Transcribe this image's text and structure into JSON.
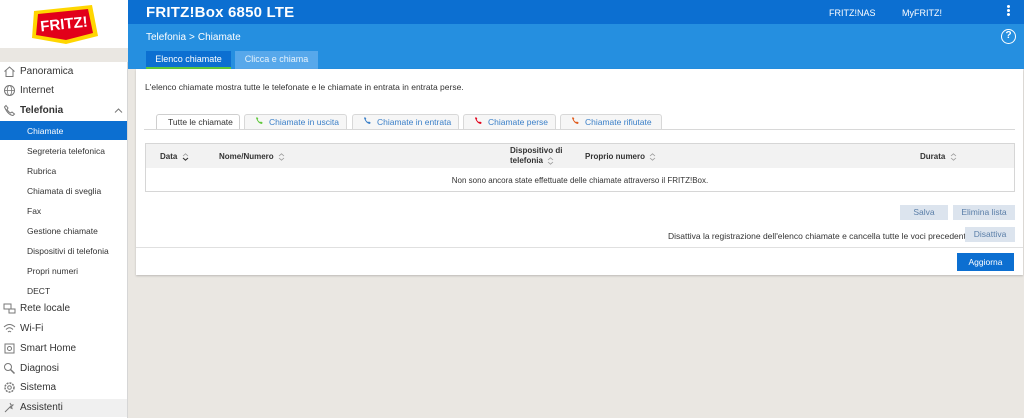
{
  "header": {
    "logo_text": "FRITZ!",
    "product_title": "FRITZ!Box 6850 LTE",
    "links": [
      "FRITZ!NAS",
      "MyFRITZ!"
    ]
  },
  "breadcrumb": {
    "section": "Telefonia",
    "separator": ">",
    "page": "Chiamate"
  },
  "help_label": "?",
  "subtabs": [
    "Elenco chiamate",
    "Clicca e chiama"
  ],
  "sidebar": {
    "items": [
      {
        "label": "Panoramica",
        "icon": "home-icon"
      },
      {
        "label": "Internet",
        "icon": "globe-icon"
      },
      {
        "label": "Telefonia",
        "icon": "phone-icon",
        "expanded": true
      },
      {
        "label": "Rete locale",
        "icon": "network-icon"
      },
      {
        "label": "Wi-Fi",
        "icon": "wifi-icon"
      },
      {
        "label": "Smart Home",
        "icon": "smart-home-icon"
      },
      {
        "label": "Diagnosi",
        "icon": "diagnosis-icon"
      },
      {
        "label": "Sistema",
        "icon": "gear-icon"
      },
      {
        "label": "Assistenti",
        "icon": "wizard-icon"
      }
    ],
    "telefonia_sub": [
      "Chiamate",
      "Segreteria telefonica",
      "Rubrica",
      "Chiamata di sveglia",
      "Fax",
      "Gestione chiamate",
      "Dispositivi di telefonia",
      "Propri numeri",
      "DECT"
    ]
  },
  "main": {
    "intro": "L'elenco chiamate mostra tutte le telefonate e le chiamate in entrata in entrata perse.",
    "tabs": [
      "Tutte le chiamate",
      "Chiamate in uscita",
      "Chiamate in entrata",
      "Chiamate perse",
      "Chiamate rifiutate"
    ],
    "table": {
      "headers": {
        "data": "Data",
        "nome": "Nome/Numero",
        "dispositivo_1": "Dispositivo di",
        "dispositivo_2": "telefonia",
        "numero": "Proprio numero",
        "durata": "Durata"
      },
      "empty_message": "Non sono ancora state effettuate delle chiamate attraverso il FRITZ!Box."
    },
    "buttons": {
      "salva": "Salva",
      "elimina": "Elimina lista",
      "disattiva": "Disattiva",
      "aggiorna": "Aggiorna"
    },
    "disable_text": "Disattiva la registrazione dell'elenco chiamate e cancella tutte le voci precedenti."
  },
  "colors": {
    "brand_blue": "#0c6fd1",
    "sub_blue": "#258fe0",
    "logo_red": "#e2001a",
    "accent_green": "#5ec83a"
  }
}
